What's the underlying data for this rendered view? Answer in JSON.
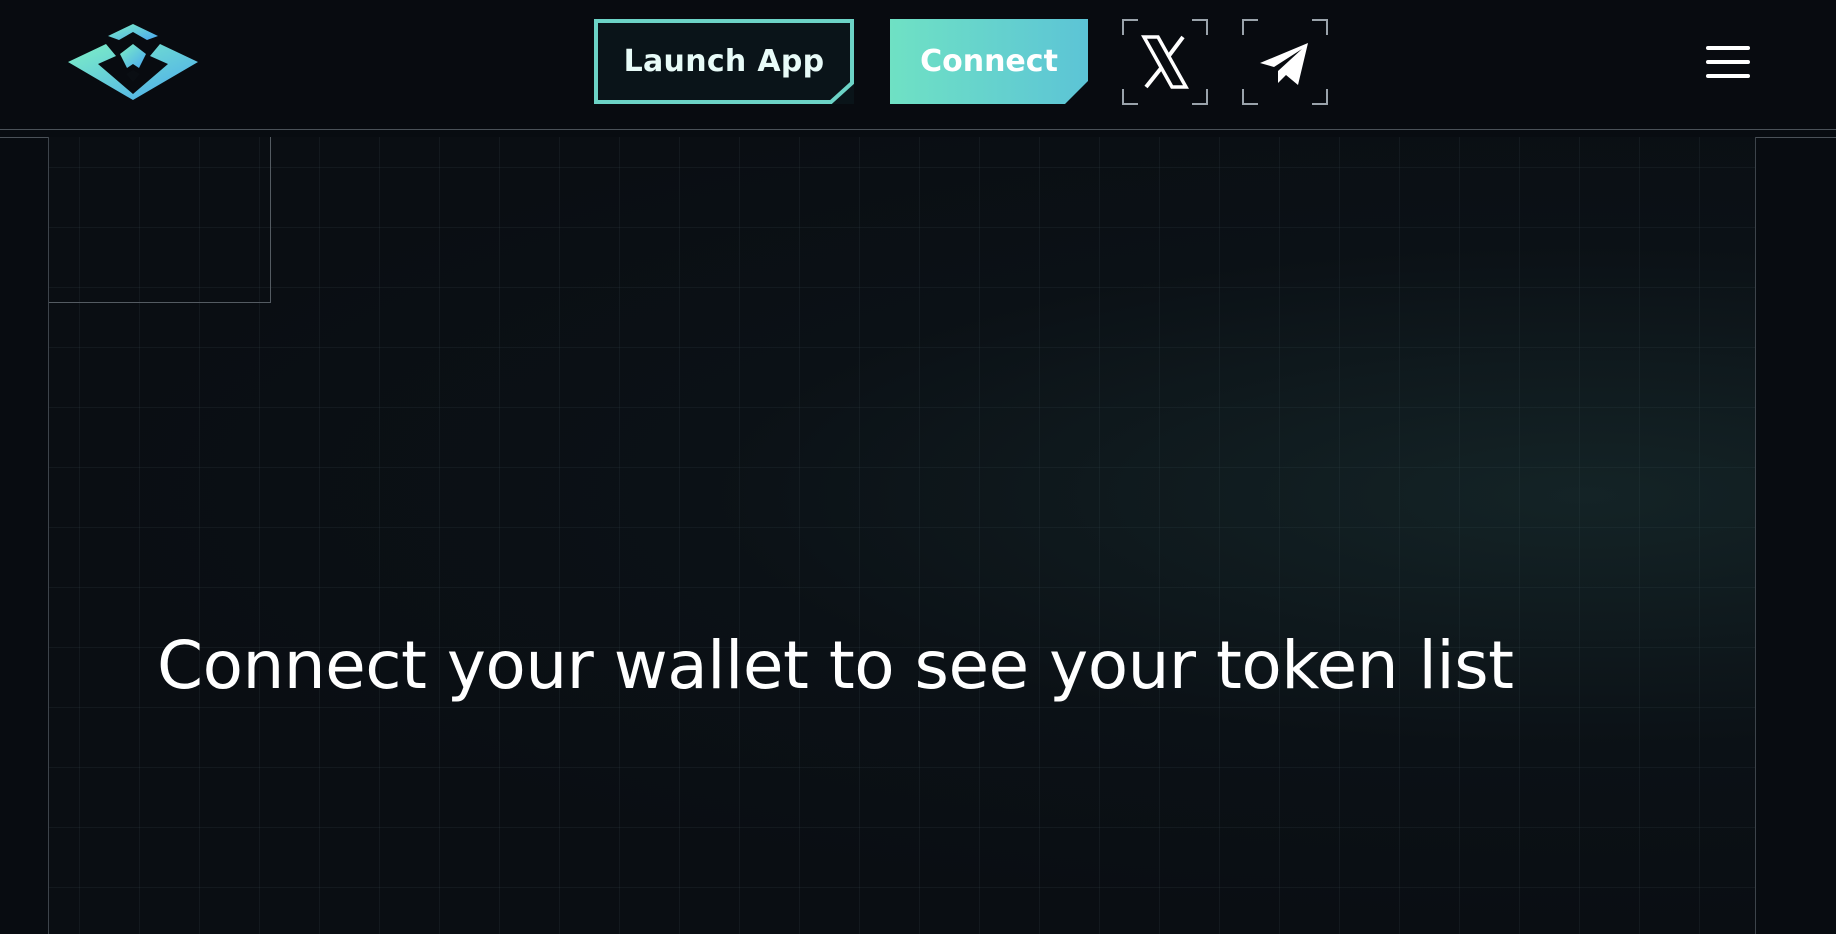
{
  "header": {
    "launch_app_label": "Launch App",
    "connect_label": "Connect",
    "icons": {
      "logo": "brand-logo-icon",
      "x": "x-twitter-icon",
      "telegram": "telegram-icon",
      "menu": "hamburger-menu-icon"
    }
  },
  "main": {
    "message": "Connect your wallet to see your token list"
  },
  "colors": {
    "background": "#080c11",
    "accent_teal": "#6de0c8",
    "accent_blue": "#5bb7e6",
    "text": "#ffffff"
  }
}
